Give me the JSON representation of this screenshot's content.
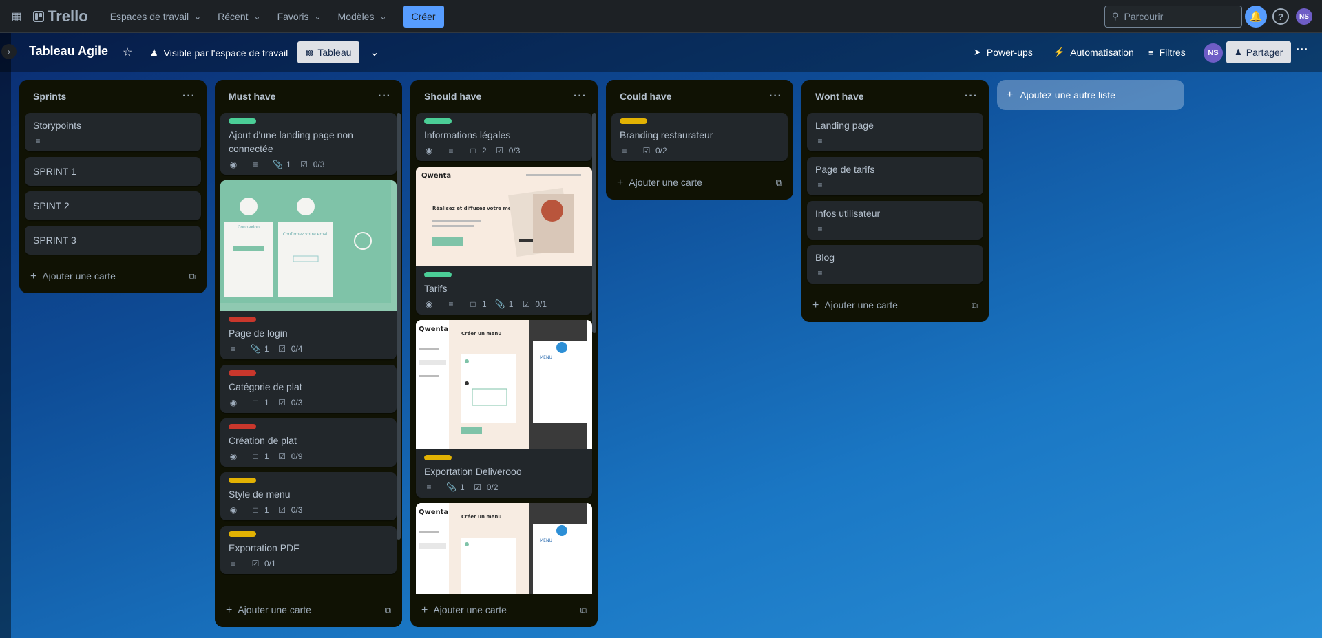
{
  "topnav": {
    "logo": "Trello",
    "menus": [
      "Espaces de travail",
      "Récent",
      "Favoris",
      "Modèles"
    ],
    "create_label": "Créer",
    "search_placeholder": "Parcourir",
    "avatar_initials": "NS"
  },
  "board": {
    "title": "Tableau Agile",
    "visibility_label": "Visible par l'espace de travail",
    "view_label": "Tableau",
    "powerups_label": "Power-ups",
    "automation_label": "Automatisation",
    "filters_label": "Filtres",
    "avatar_initials": "NS",
    "share_label": "Partager",
    "add_list_label": "Ajoutez une autre liste",
    "add_card_label": "Ajouter une carte"
  },
  "colors": {
    "green_label": "#4bce97",
    "red_label": "#c9372c",
    "yellow_label": "#e2b203",
    "accent": "#579dff"
  },
  "lists": [
    {
      "title": "Sprints",
      "cards": [
        {
          "title": "Storypoints",
          "badges": [
            {
              "icon": "description-icon"
            }
          ]
        },
        {
          "title": "SPRINT 1"
        },
        {
          "title": "SPINT 2"
        },
        {
          "title": "SPRINT 3"
        }
      ]
    },
    {
      "title": "Must have",
      "cards": [
        {
          "label": "green",
          "title": "Ajout d'une landing page non connectée",
          "badges": [
            {
              "icon": "eye-icon"
            },
            {
              "icon": "description-icon"
            },
            {
              "icon": "attachment-icon",
              "text": "1"
            },
            {
              "icon": "checklist-icon",
              "text": "0/3"
            }
          ]
        },
        {
          "cover": "login-mockup",
          "label": "red",
          "title": "Page de login",
          "badges": [
            {
              "icon": "description-icon"
            },
            {
              "icon": "attachment-icon",
              "text": "1"
            },
            {
              "icon": "checklist-icon",
              "text": "0/4"
            }
          ]
        },
        {
          "label": "red",
          "title": "Catégorie de plat",
          "badges": [
            {
              "icon": "eye-icon"
            },
            {
              "icon": "comment-icon",
              "text": "1"
            },
            {
              "icon": "checklist-icon",
              "text": "0/3"
            }
          ]
        },
        {
          "label": "red",
          "title": "Création de plat",
          "badges": [
            {
              "icon": "eye-icon"
            },
            {
              "icon": "comment-icon",
              "text": "1"
            },
            {
              "icon": "checklist-icon",
              "text": "0/9"
            }
          ]
        },
        {
          "label": "yellow",
          "title": "Style de menu",
          "badges": [
            {
              "icon": "eye-icon"
            },
            {
              "icon": "comment-icon",
              "text": "1"
            },
            {
              "icon": "checklist-icon",
              "text": "0/3"
            }
          ]
        },
        {
          "label": "yellow",
          "title": "Exportation PDF",
          "badges": [
            {
              "icon": "description-icon"
            },
            {
              "icon": "checklist-icon",
              "text": "0/1"
            }
          ]
        }
      ]
    },
    {
      "title": "Should have",
      "cards": [
        {
          "label": "green",
          "title": "Informations légales",
          "badges": [
            {
              "icon": "eye-icon"
            },
            {
              "icon": "description-icon"
            },
            {
              "icon": "comment-icon",
              "text": "2"
            },
            {
              "icon": "checklist-icon",
              "text": "0/3"
            }
          ]
        },
        {
          "cover": "qwenta-landing",
          "label": "green",
          "title": "Tarifs",
          "badges": [
            {
              "icon": "eye-icon"
            },
            {
              "icon": "description-icon"
            },
            {
              "icon": "comment-icon",
              "text": "1"
            },
            {
              "icon": "attachment-icon",
              "text": "1"
            },
            {
              "icon": "checklist-icon",
              "text": "0/1"
            }
          ]
        },
        {
          "cover": "qwenta-menu",
          "label": "yellow",
          "title": "Exportation Deliverooo",
          "badges": [
            {
              "icon": "description-icon"
            },
            {
              "icon": "attachment-icon",
              "text": "1"
            },
            {
              "icon": "checklist-icon",
              "text": "0/2"
            }
          ]
        },
        {
          "cover": "qwenta-menu-2"
        }
      ]
    },
    {
      "title": "Could have",
      "cards": [
        {
          "label": "yellow",
          "title": "Branding restaurateur",
          "badges": [
            {
              "icon": "description-icon"
            },
            {
              "icon": "checklist-icon",
              "text": "0/2"
            }
          ]
        }
      ]
    },
    {
      "title": "Wont have",
      "cards": [
        {
          "title": "Landing page",
          "badges": [
            {
              "icon": "description-icon"
            }
          ]
        },
        {
          "title": "Page de tarifs",
          "badges": [
            {
              "icon": "description-icon"
            }
          ]
        },
        {
          "title": "Infos utilisateur",
          "badges": [
            {
              "icon": "description-icon"
            }
          ]
        },
        {
          "title": "Blog",
          "badges": [
            {
              "icon": "description-icon"
            }
          ]
        }
      ]
    }
  ],
  "covers": {
    "login": {
      "text1": "Connexion",
      "text2": "Confirmez votre email"
    },
    "qwenta": {
      "brand": "Qwenta",
      "headline": "Réalisez et diffusez votre menu personalisé",
      "menu_title": "Créer un menu",
      "menu_word": "MENU"
    }
  }
}
